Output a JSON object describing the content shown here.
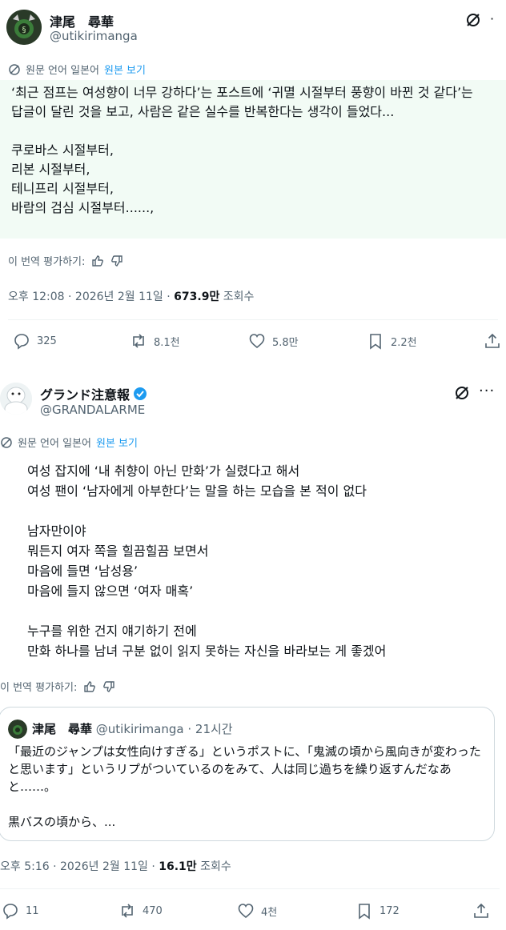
{
  "tweet1": {
    "name": "津尾　尋華",
    "handle": "@utikirimanga",
    "translation_note": "원문 언어 일본어",
    "view_original": "원본 보기",
    "body": "‘최근 점프는 여성향이 너무 강하다’는 포스트에 ‘귀멸 시절부터 풍향이 바뀐 것 같다’는 답글이 달린 것을 보고, 사람은 같은 실수를 반복한다는 생각이 들었다...\n\n쿠로바스 시절부터,\n리본 시절부터,\n테니프리 시절부터,\n바람의 검심 시절부터......,",
    "rate_label": "이 번역 평가하기:",
    "time": "오후 12:08 · 2026년 2월 11일 · ",
    "views_count": "673.9만",
    "views_label": " 조회수",
    "replies": "325",
    "retweets": "8.1천",
    "likes": "5.8만",
    "bookmarks": "2.2천"
  },
  "tweet2": {
    "name": "グランド注意報",
    "handle": "@GRANDALARME",
    "translation_note": "원문 언어 일본어",
    "view_original": "원본 보기",
    "body": "여성 잡지에 ‘내 취향이 아닌 만화’가 실렸다고 해서\n여성 팬이 ‘남자에게 아부한다’는 말을 하는 모습을 본 적이 없다\n\n남자만이야\n뭐든지 여자 쪽을 힐끔힐끔 보면서\n마음에 들면 ‘남성용’\n마음에 들지 않으면 ‘여자 매혹’\n\n누구를 위한 건지 얘기하기 전에\n만화 하나를 남녀 구분 없이 읽지 못하는 자신을 바라보는 게 좋겠어",
    "rate_label": "이 번역 평가하기:",
    "quote": {
      "name": "津尾　尋華",
      "handle": "@utikirimanga",
      "time": "· 21시간",
      "text": "「最近のジャンプは女性向けすぎる」というポストに、「鬼滅の頃から風向きが変わったと思います」というリプがついているのをみて、人は同じ過ちを繰り返すんだなあと……。\n\n黒バスの頃から、..."
    },
    "time": "오후 5:16 · 2026년 2월 11일 · ",
    "views_count": "16.1만",
    "views_label": " 조회수",
    "replies": "11",
    "retweets": "470",
    "likes": "4천",
    "bookmarks": "172"
  },
  "colors": {
    "text": "#0f1419",
    "secondary": "#536471",
    "link": "#1d9bf0",
    "highlight_bg": "#f2fbf5",
    "verified": "#1d9bf0"
  }
}
